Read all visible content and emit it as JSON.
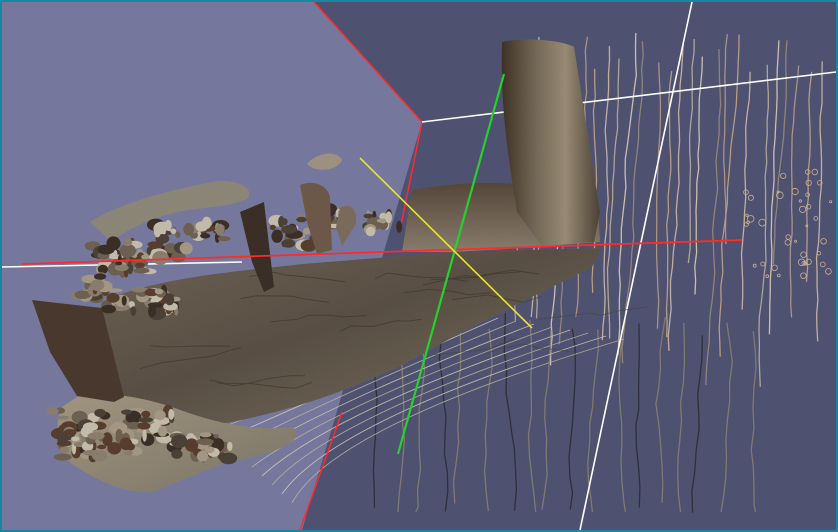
{
  "viewport": {
    "frame_color": "#1b86a3",
    "background_color": "#4e5170",
    "near_plane_color": "#75789c"
  },
  "axes": {
    "x_color": "#ff2a2a",
    "y_color": "#25d12a",
    "z_color": "#e6e62a"
  },
  "guides": {
    "boundary_line_color": "#ffffff",
    "plane_edge_color": "#ff2a2a"
  },
  "point_cloud": {
    "colors": [
      "#4d4237",
      "#6f6253",
      "#8c7f6f",
      "#a79a86",
      "#5a3f2f",
      "#c7bfae",
      "#3c2f27"
    ]
  }
}
